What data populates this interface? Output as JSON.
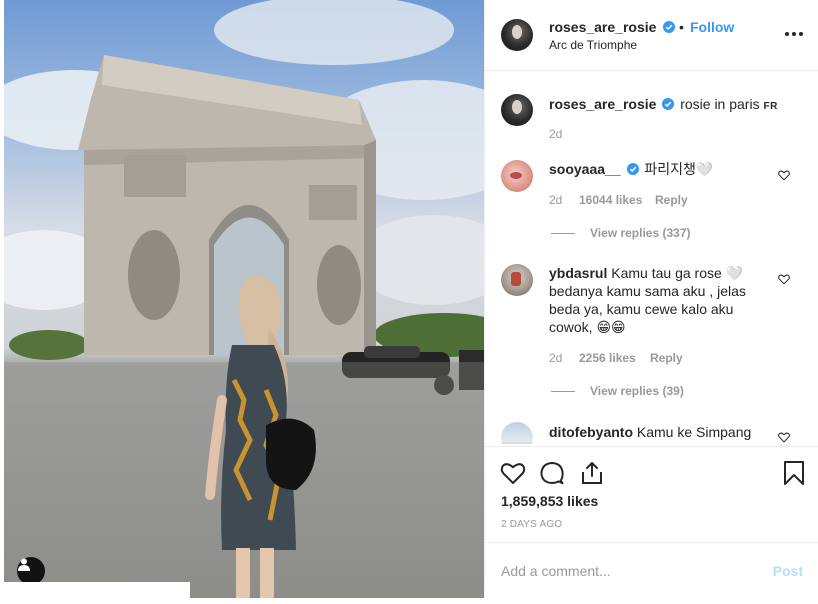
{
  "post": {
    "author": "roses_are_rosie",
    "location": "Arc de Triomphe",
    "follow_label": "Follow",
    "separator": "•",
    "verified_color": "#3897f0"
  },
  "caption": {
    "username": "roses_are_rosie",
    "text": "rosie in paris",
    "flag": "FR",
    "time": "2d"
  },
  "comments": [
    {
      "username": "sooyaaa__",
      "verified": true,
      "text": "파리지챙🤍",
      "time": "2d",
      "likes": "16044 likes",
      "reply_label": "Reply",
      "view_replies": "View replies (337)"
    },
    {
      "username": "ybdasrul",
      "verified": false,
      "text": "Kamu tau ga rose 🤍 bedanya kamu sama aku , jelas beda ya, kamu cewe kalo aku cowok, 😁😁",
      "time": "2d",
      "likes": "2256 likes",
      "reply_label": "Reply",
      "view_replies": "View replies (39)"
    },
    {
      "username": "ditofebyanto",
      "verified": false,
      "text": "Kamu ke Simpang"
    }
  ],
  "actions": {
    "likes": "1,859,853 likes",
    "time_ago": "2 DAYS AGO",
    "icons": [
      "heart-icon",
      "comment-icon",
      "share-icon",
      "bookmark-icon"
    ]
  },
  "add_comment": {
    "placeholder": "Add a comment...",
    "post_label": "Post"
  },
  "colors": {
    "accent": "#3897f0",
    "muted": "#999999",
    "post_disabled": "#b2dffc",
    "text": "#262626"
  }
}
